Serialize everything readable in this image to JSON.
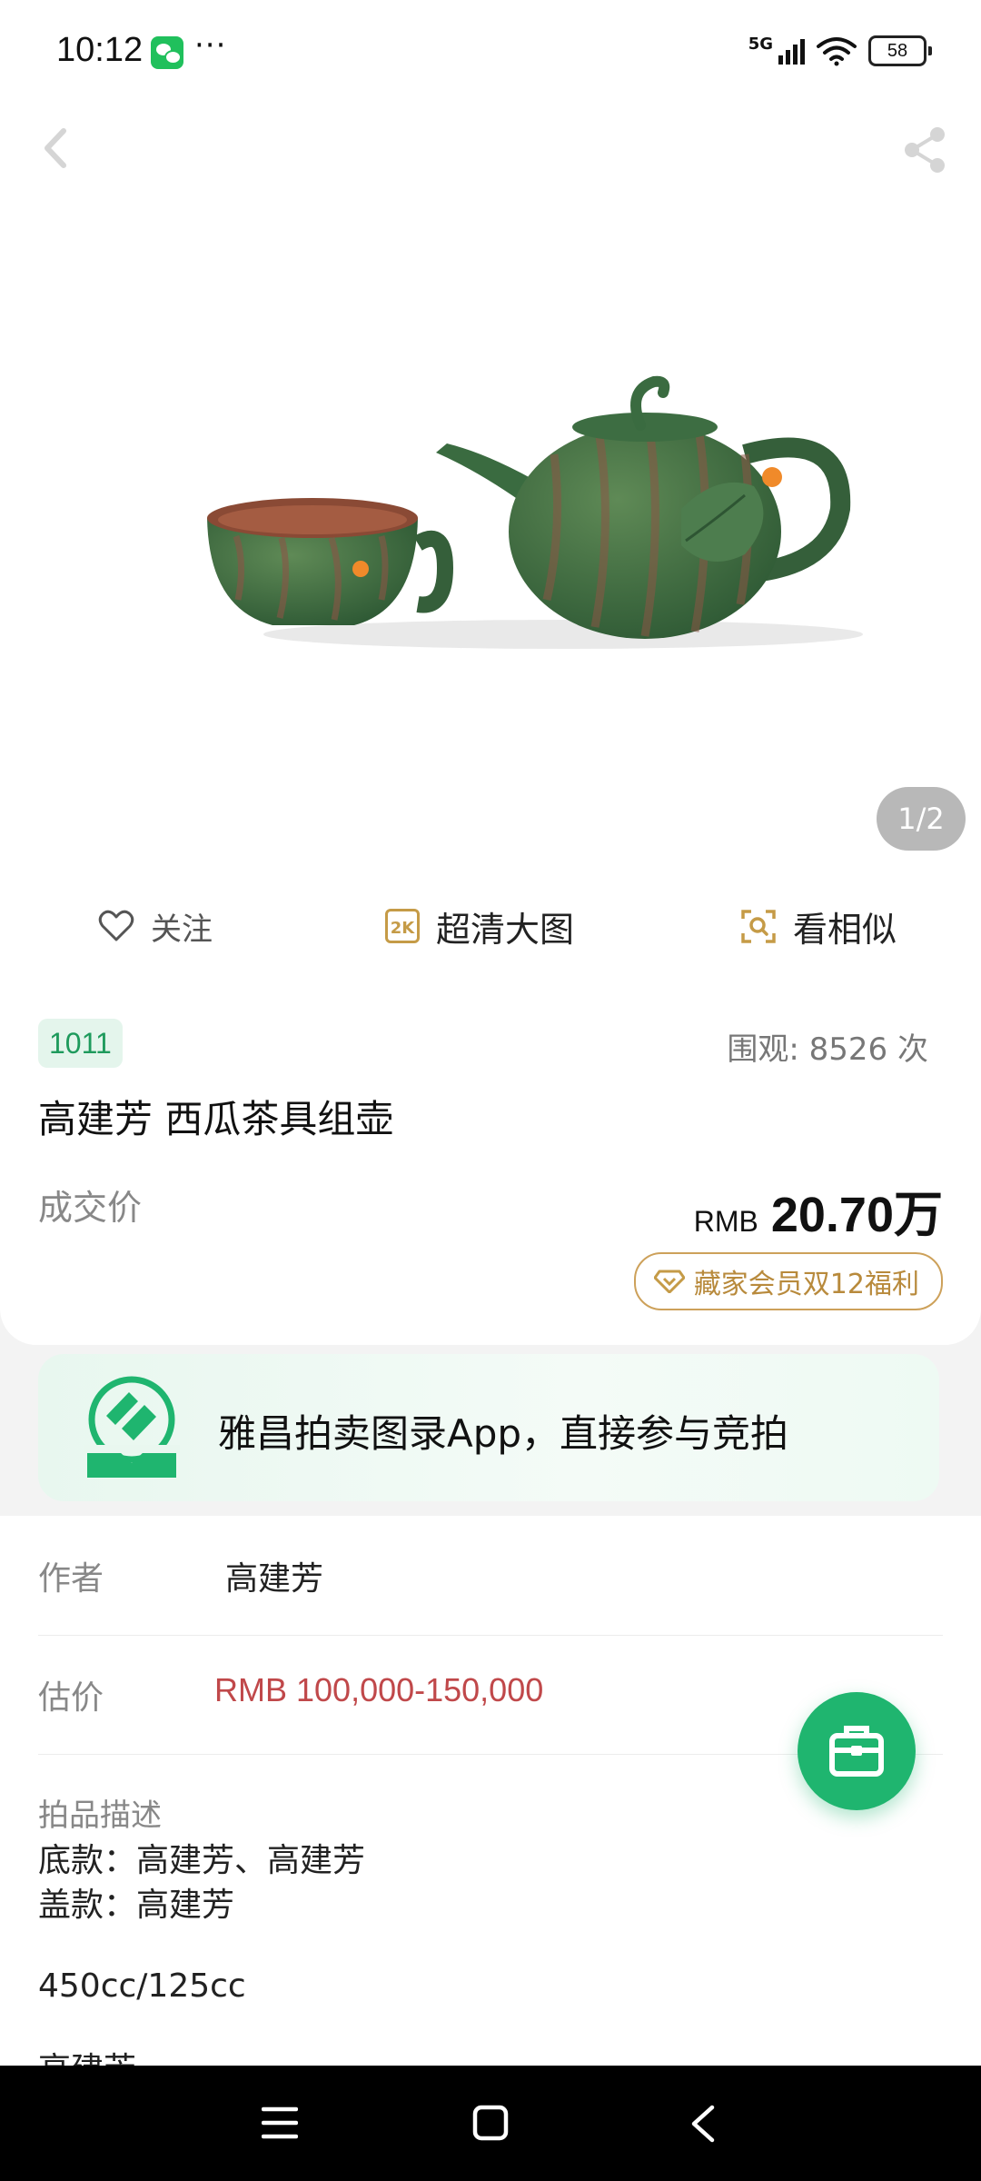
{
  "status_bar": {
    "time": "10:12",
    "more": "···",
    "network": "5G",
    "battery": "58"
  },
  "image": {
    "counter": "1/2"
  },
  "actions": {
    "follow": "关注",
    "hd_badge": "2K",
    "hd": "超清大图",
    "similar": "看相似"
  },
  "info": {
    "lot": "1011",
    "views": "围观: 8526 次",
    "title": "高建芳 西瓜茶具组壶",
    "deal_label": "成交价",
    "currency": "RMB",
    "price": "20.70万",
    "welfare": "藏家会员双12福利"
  },
  "banner": {
    "text": "雅昌拍卖图录App，直接参与竞拍"
  },
  "details": {
    "author_label": "作者",
    "author": "高建芳",
    "estimate_label": "估价",
    "estimate": "RMB  100,000-150,000",
    "desc_title": "拍品描述",
    "desc_line1": "底款：高建芳、高建芳",
    "desc_line2": "盖款：高建芳",
    "desc_line3": "450cc/125cc",
    "desc_line4": "高建芳"
  },
  "colors": {
    "brand_green": "#1fb56f",
    "estimate_red": "#c0484a",
    "gold": "#c59b47"
  }
}
